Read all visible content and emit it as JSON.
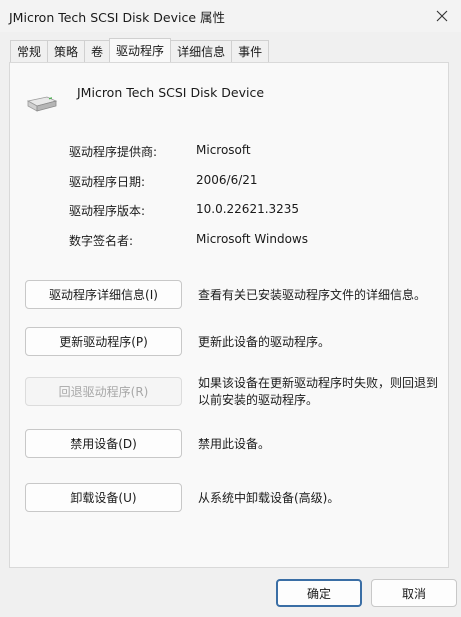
{
  "window": {
    "title": "JMicron Tech SCSI Disk Device 属性",
    "close_icon": "close-icon"
  },
  "tabs": [
    {
      "label": "常规"
    },
    {
      "label": "策略"
    },
    {
      "label": "卷"
    },
    {
      "label": "驱动程序",
      "active": true
    },
    {
      "label": "详细信息"
    },
    {
      "label": "事件"
    }
  ],
  "device": {
    "name": "JMicron Tech SCSI Disk Device",
    "icon": "disk-drive-icon"
  },
  "properties": [
    {
      "label": "驱动程序提供商:",
      "value": "Microsoft"
    },
    {
      "label": "驱动程序日期:",
      "value": "2006/6/21"
    },
    {
      "label": "驱动程序版本:",
      "value": "10.0.22621.3235"
    },
    {
      "label": "数字签名者:",
      "value": "Microsoft Windows"
    }
  ],
  "actions": [
    {
      "label": "驱动程序详细信息(I)",
      "desc": "查看有关已安装驱动程序文件的详细信息。",
      "enabled": true
    },
    {
      "label": "更新驱动程序(P)",
      "desc": "更新此设备的驱动程序。",
      "enabled": true
    },
    {
      "label": "回退驱动程序(R)",
      "desc": "如果该设备在更新驱动程序时失败，则回退到以前安装的驱动程序。",
      "enabled": false
    },
    {
      "label": "禁用设备(D)",
      "desc": "禁用此设备。",
      "enabled": true
    },
    {
      "label": "卸载设备(U)",
      "desc": "从系统中卸载设备(高级)。",
      "enabled": true
    }
  ],
  "footer": {
    "ok_label": "确定",
    "cancel_label": "取消"
  },
  "colors": {
    "dialog_bg": "#f0f0f0",
    "panel_bg": "#f9f9f9",
    "default_button_border": "#3a6ea5",
    "disabled_text": "#a8a8a8"
  }
}
